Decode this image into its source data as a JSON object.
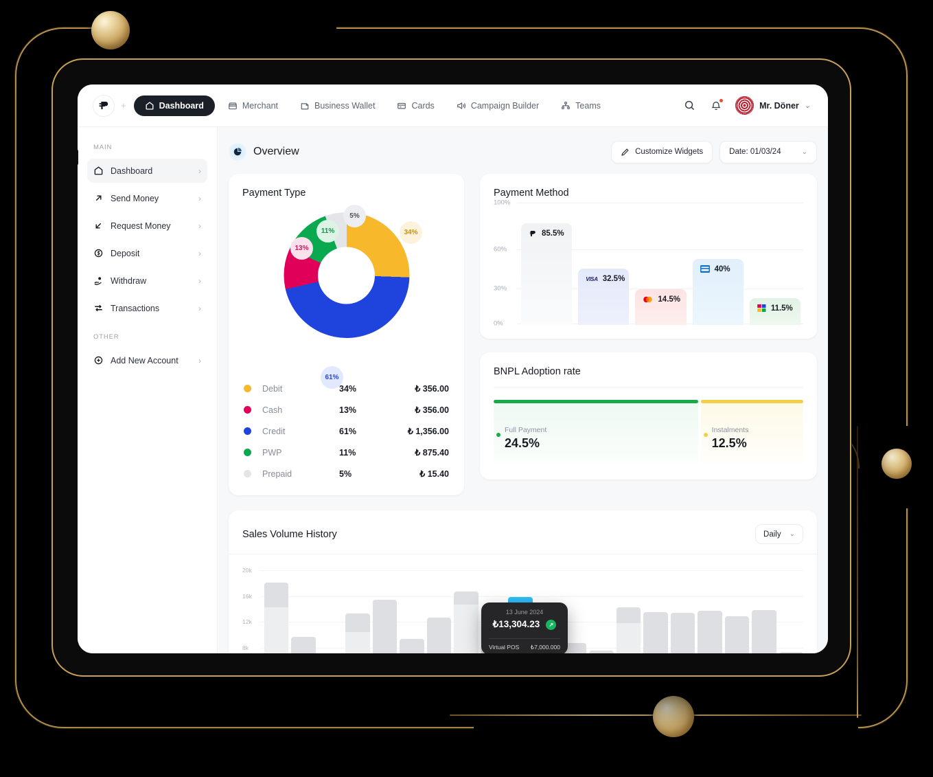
{
  "topnav": {
    "brand_logo": "brand-p-logo",
    "plus": "+",
    "items": [
      {
        "label": "Dashboard",
        "icon": "home-icon",
        "active": true
      },
      {
        "label": "Merchant",
        "icon": "store-icon",
        "active": false
      },
      {
        "label": "Business Wallet",
        "icon": "wallet-icon",
        "active": false
      },
      {
        "label": "Cards",
        "icon": "card-icon",
        "active": false
      },
      {
        "label": "Campaign Builder",
        "icon": "megaphone-icon",
        "active": false
      },
      {
        "label": "Teams",
        "icon": "teams-icon",
        "active": false
      }
    ],
    "search_icon": "search-icon",
    "bell_icon": "bell-icon",
    "user_name": "Mr. Döner",
    "user_caret": "⌄"
  },
  "sidebar": {
    "group_main": "MAIN",
    "group_other": "OTHER",
    "main_items": [
      {
        "label": "Dashboard",
        "icon": "home-icon",
        "chevron": "›",
        "active": true
      },
      {
        "label": "Send Money",
        "icon": "arrow-up-right-icon",
        "chevron": "›",
        "active": false
      },
      {
        "label": "Request Money",
        "icon": "arrow-down-left-icon",
        "chevron": "›",
        "active": false
      },
      {
        "label": "Deposit",
        "icon": "coin-icon",
        "chevron": "›",
        "active": false
      },
      {
        "label": "Withdraw",
        "icon": "hand-coin-icon",
        "chevron": "›",
        "active": false
      },
      {
        "label": "Transactions",
        "icon": "transfer-icon",
        "chevron": "›",
        "active": false
      }
    ],
    "other_items": [
      {
        "label": "Add New Account",
        "icon": "plus-circle-icon",
        "chevron": "›",
        "active": false
      }
    ]
  },
  "header": {
    "icon": "pie-chart-icon",
    "title": "Overview",
    "customize_label": "Customize Widgets",
    "customize_icon": "pencil-icon",
    "date_label": "Date: 01/03/24",
    "date_caret": "⌄"
  },
  "chart_data": [
    {
      "type": "pie",
      "title": "Payment Type",
      "legend_position": "bottom",
      "labels": [
        "Debit",
        "Cash",
        "Credit",
        "PWP",
        "Prepaid"
      ],
      "values": [
        34,
        13,
        61,
        11,
        5
      ],
      "value_suffix": "%",
      "amounts": [
        "₺ 356.00",
        "₺ 356.00",
        "₺ 1,356.00",
        "₺ 875.40",
        "₺ 15.40"
      ],
      "percent_labels": [
        "34%",
        "13%",
        "61%",
        "11%",
        "5%"
      ],
      "colors": [
        "#f7b82b",
        "#e0005a",
        "#1f44dd",
        "#0aa94f",
        "#e3e5e8"
      ],
      "bubble_bg": [
        "#fdf3dc",
        "#fce0eb",
        "#e2e8fd",
        "#dcf3e5",
        "#eceef1"
      ],
      "slices": [
        {
          "label": "Debit",
          "percent": 34,
          "sweep": 92,
          "color": "#f7b82b"
        },
        {
          "label": "Credit",
          "percent": 61,
          "sweep": 165,
          "color": "#1f44dd"
        },
        {
          "label": "Cash",
          "percent": 13,
          "sweep": 38,
          "color": "#e0005a"
        },
        {
          "label": "PWP",
          "percent": 11,
          "sweep": 45,
          "color": "#0aa94f"
        },
        {
          "label": "Prepaid",
          "percent": 5,
          "sweep": 20,
          "color": "#e3e5e8"
        }
      ]
    },
    {
      "type": "bar",
      "title": "Payment Method",
      "categories": [
        "Papara",
        "Visa",
        "Mastercard",
        "Troy",
        "Amex"
      ],
      "values": [
        85.5,
        32.5,
        14.5,
        40,
        11.5
      ],
      "value_labels": [
        "85.5%",
        "32.5%",
        "14.5%",
        "40%",
        "11.5%"
      ],
      "ylim": [
        0,
        100
      ],
      "yticks": [
        "0%",
        "30%",
        "60%",
        "100%"
      ],
      "grid": true,
      "bar_colors": [
        "#f2f3f5",
        "#e6eafa",
        "#fde8e8",
        "#e3f1fc",
        "#e4f4e6"
      ],
      "icons": [
        "papara-icon",
        "visa-icon",
        "mastercard-icon",
        "troy-icon",
        "amex-icon"
      ]
    },
    {
      "type": "bar",
      "title": "Sales Volume History",
      "range_selector": "Daily",
      "range_caret": "⌄",
      "yticks": [
        "8k",
        "12k",
        "16k",
        "20k"
      ],
      "ylim": [
        0,
        22000
      ],
      "grid": true,
      "values": [
        18000,
        6500,
        0,
        11500,
        14400,
        6000,
        10600,
        16200,
        8500,
        14900,
        11500,
        5200,
        3500,
        12800,
        11800,
        11600,
        12000,
        10800,
        12200,
        3200
      ],
      "lower_segment": [
        12800,
        0,
        0,
        7500,
        0,
        0,
        0,
        13300,
        0,
        8300,
        0,
        0,
        0,
        9400,
        0,
        0,
        0,
        0,
        0,
        0
      ],
      "highlight_index": 9,
      "highlight_color": "#1463e6"
    }
  ],
  "bnpl": {
    "title": "BNPL Adoption rate",
    "segments": [
      {
        "label": "Full Payment",
        "value": "24.5%",
        "color": "#18a94a",
        "bg": "#eef9f1"
      },
      {
        "label": "Instalments",
        "value": "12.5%",
        "color": "#f2cf4a",
        "bg": "#fdf9e7"
      }
    ]
  },
  "tooltip": {
    "date": "13 June 2024",
    "amount": "₺13,304.23",
    "badge": "↗",
    "source_label": "Virtual POS",
    "source_value": "₺7,000.000"
  }
}
